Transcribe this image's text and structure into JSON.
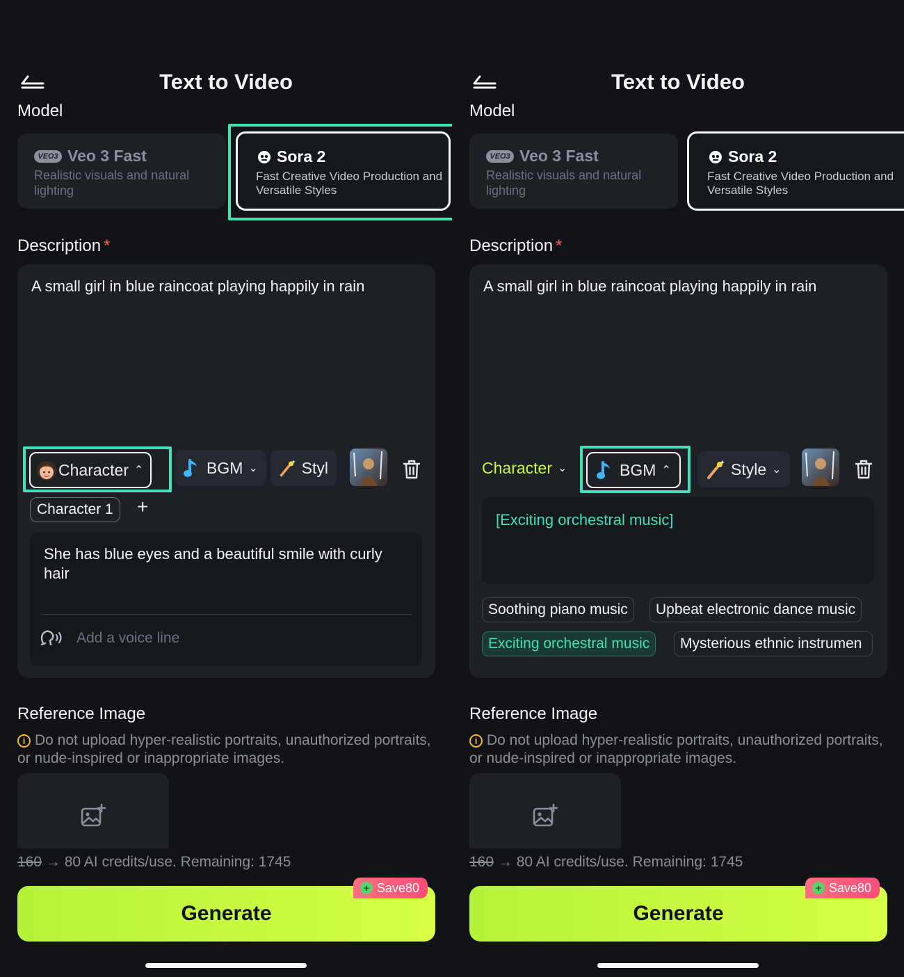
{
  "colors": {
    "accent_highlight": "#43e0b4",
    "generate_button": "#c8f83f",
    "background": "#111316",
    "card": "#1d2025",
    "save_badge": "#ff5b7b"
  },
  "screens": [
    {
      "title": "Text to Video",
      "model_label": "Model",
      "models": [
        {
          "badge": "VEO3",
          "name": "Veo 3 Fast",
          "desc": "Realistic visuals and natural lighting",
          "icon": "veo-badge-icon"
        },
        {
          "name": "Sora 2",
          "desc": "Fast Creative Video Production and Versatile Styles",
          "icon": "sora-logo-icon",
          "selected": true
        }
      ],
      "description_label": "Description",
      "required_mark": "*",
      "description_text": "A small girl in blue raincoat playing happily in rain",
      "chips": {
        "character": "Character",
        "bgm": "BGM",
        "style": "Styl"
      },
      "character_tag": "Character 1",
      "add_symbol": "+",
      "character_desc": "She has blue eyes and a beautiful smile with curly hair",
      "voice_placeholder": "Add a voice line",
      "reference_label": "Reference Image",
      "warning": "Do not upload hyper-realistic portraits, unauthorized portraits, or nude-inspired or inappropriate images.",
      "credits_old": "160",
      "credits_arrow": "→",
      "credits_text": "80 AI credits/use. Remaining: 1745",
      "save_badge": "Save80",
      "generate": "Generate"
    },
    {
      "title": "Text to Video",
      "model_label": "Model",
      "models": [
        {
          "badge": "VEO3",
          "name": "Veo 3 Fast",
          "desc": "Realistic visuals and natural lighting",
          "icon": "veo-badge-icon"
        },
        {
          "name": "Sora 2",
          "desc": "Fast Creative Video Production and Versatile Styles",
          "icon": "sora-logo-icon",
          "selected": true
        }
      ],
      "description_label": "Description",
      "required_mark": "*",
      "description_text": "A small girl in blue raincoat playing happily in rain",
      "chips": {
        "character": "Character",
        "bgm": "BGM",
        "style": "Style"
      },
      "bgm_selected_text": "[Exciting orchestral music]",
      "bgm_suggestions": [
        {
          "label": "Soothing piano music",
          "active": false
        },
        {
          "label": "Upbeat electronic dance music",
          "active": false
        },
        {
          "label": "Exciting orchestral music",
          "active": true
        },
        {
          "label": "Mysterious ethnic instrumen",
          "active": false
        }
      ],
      "reference_label": "Reference Image",
      "warning": "Do not upload hyper-realistic portraits, unauthorized portraits, or nude-inspired or inappropriate images.",
      "credits_old": "160",
      "credits_arrow": "→",
      "credits_text": "80 AI credits/use. Remaining: 1745",
      "save_badge": "Save80",
      "generate": "Generate"
    }
  ]
}
